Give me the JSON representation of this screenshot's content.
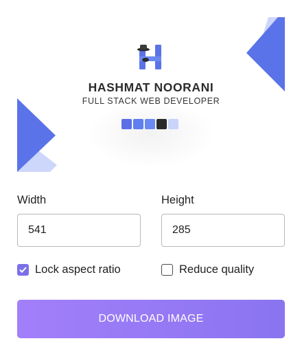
{
  "preview": {
    "brand_name": "HASHMAT NOORANI",
    "brand_tagline": "FULL STACK WEB DEVELOPER",
    "logo_icon": "hashmat-h-logo-icon",
    "palette": [
      "#5b6fe6",
      "#5f7ff0",
      "#6b89f2",
      "#2a2a2a",
      "#c9d3fb"
    ],
    "accent_color": "#5b73e8",
    "accent_light_color": "#cdd6fb"
  },
  "width": {
    "label": "Width",
    "value": "541"
  },
  "height": {
    "label": "Height",
    "value": "285"
  },
  "options": {
    "lock_aspect": {
      "label": "Lock aspect ratio",
      "checked": true
    },
    "reduce_quality": {
      "label": "Reduce quality",
      "checked": false
    }
  },
  "download": {
    "label": "DOWNLOAD IMAGE",
    "color_start": "#a37ffa",
    "color_end": "#8a74f0"
  }
}
